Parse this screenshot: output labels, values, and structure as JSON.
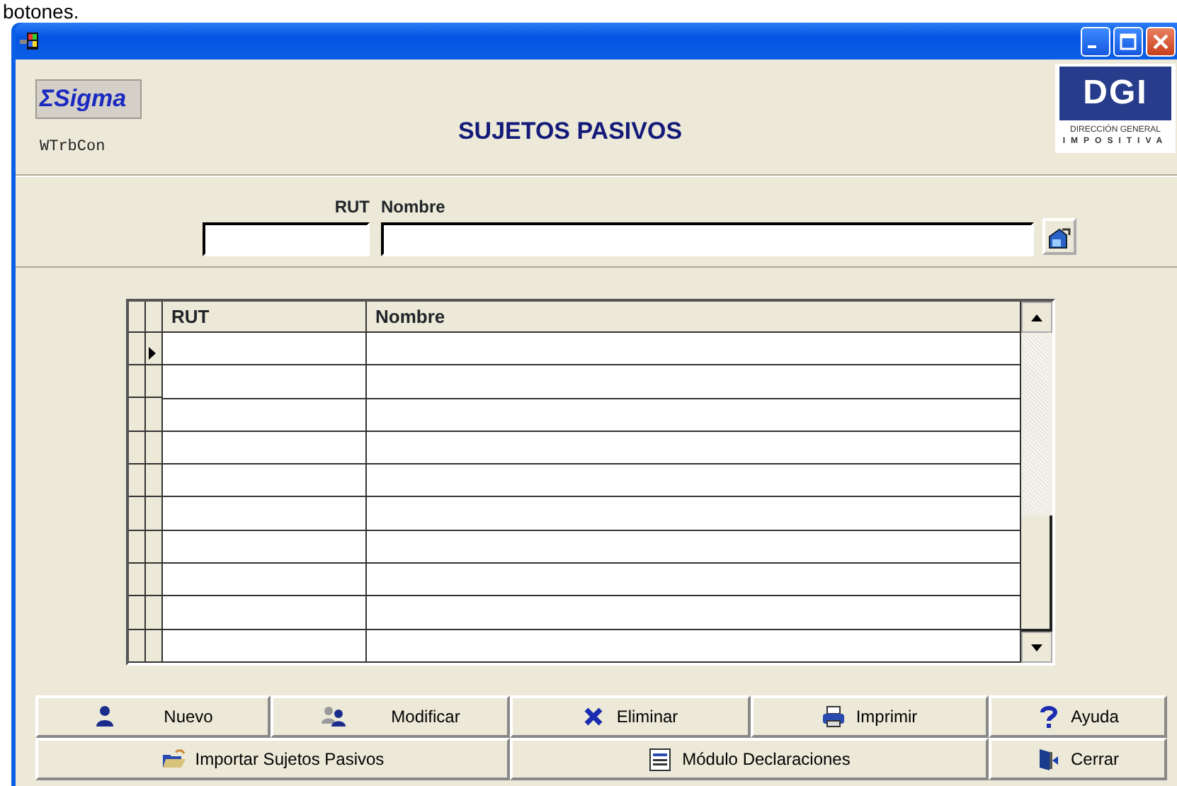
{
  "caption": "botones.",
  "header": {
    "logo": "ΣSigma",
    "program_code": "WTrbCon",
    "title": "SUJETOS PASIVOS",
    "agency": {
      "mark": "DGI",
      "line1": "DIRECCIÓN GENERAL",
      "line2": "IMPOSITIVA"
    }
  },
  "search": {
    "fields": [
      {
        "label": "RUT"
      },
      {
        "label": "Nombre"
      }
    ]
  },
  "grid": {
    "columns": [
      "RUT",
      "Nombre"
    ],
    "rows": [
      {
        "selected": true
      },
      {
        "selected": false
      },
      {
        "selected": false
      },
      {
        "selected": false
      },
      {
        "selected": false
      },
      {
        "selected": false
      },
      {
        "selected": false
      },
      {
        "selected": false
      },
      {
        "selected": false
      },
      {
        "selected": false
      }
    ]
  },
  "buttons": [
    [
      {
        "kind": "new",
        "label": "Nuevo"
      },
      {
        "kind": "edit",
        "label": "Modificar"
      },
      {
        "kind": "delete",
        "label": "Eliminar"
      },
      {
        "kind": "print",
        "label": "Imprimir"
      },
      {
        "kind": "help",
        "label": "Ayuda"
      }
    ],
    [
      {
        "kind": "import",
        "label": "Importar Sujetos Pasivos"
      },
      {
        "kind": "module",
        "label": "Módulo Declaraciones"
      },
      {
        "kind": "close",
        "label": "Cerrar"
      }
    ]
  ]
}
